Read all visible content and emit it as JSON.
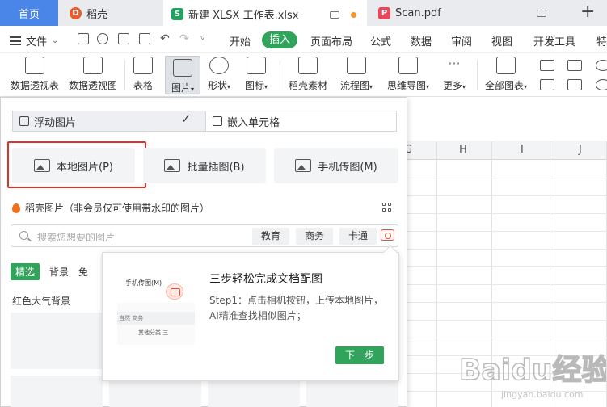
{
  "tabs": {
    "home": "首页",
    "daoke": "稻壳",
    "xlsx": "新建 XLSX 工作表.xlsx",
    "pdf": "Scan.pdf",
    "new_tab": "+"
  },
  "menu": {
    "file": "文件",
    "items": [
      "开始",
      "插入",
      "页面布局",
      "公式",
      "数据",
      "审阅",
      "视图",
      "开发工具",
      "特"
    ],
    "active": "插入"
  },
  "ribbon": {
    "items": [
      "数据透视表",
      "数据透视图",
      "表格",
      "图片",
      "形状",
      "图标",
      "稻壳素材",
      "流程图",
      "思维导图",
      "更多",
      "全部图表"
    ],
    "selected": "图片"
  },
  "sheet": {
    "columns": [
      "G",
      "H",
      "I",
      "J"
    ]
  },
  "panel": {
    "float_image": "浮动图片",
    "embed_cell": "嵌入单元格",
    "local_image": "本地图片(P)",
    "batch_insert": "批量插图(B)",
    "phone_image": "手机传图(M)",
    "daoke_images": "稻壳图片（非会员仅可使用带水印的图片）",
    "search_placeholder": "搜索您想要的图片",
    "chips": [
      "教育",
      "商务",
      "卡通"
    ],
    "categories": [
      "精选",
      "背景",
      "免"
    ],
    "section_label": "红色大气背景"
  },
  "popup": {
    "title": "三步轻松完成文档配图",
    "desc": "Step1：点击相机按钮，上传本地图片，AI精准查找相似图片；",
    "next": "下一步",
    "illus_title": "手机传图(M)",
    "illus_row": "自然    商务",
    "illus_row2": "其他分类 三"
  },
  "watermark": {
    "text": "Baidu经验",
    "sub": "jingyan.baidu.com"
  },
  "colors": {
    "accent_green": "#2fa45a",
    "home_tab": "#4a86e8",
    "highlight_red": "#e0302a"
  }
}
